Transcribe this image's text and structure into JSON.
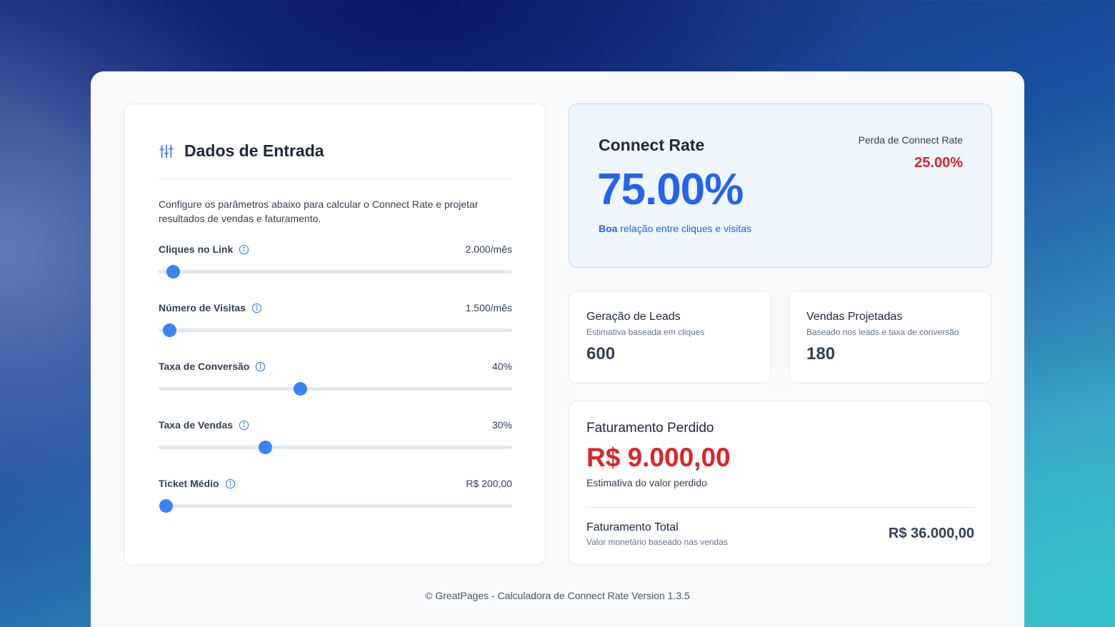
{
  "input": {
    "title": "Dados de Entrada",
    "description": "Configure os parâmetros abaixo para calcular o Connect Rate e projetar resultados de vendas e faturamento.",
    "fields": [
      {
        "label": "Cliques no Link",
        "value": "2.000/mês",
        "slider_fraction": 0.04
      },
      {
        "label": "Número de Visitas",
        "value": "1.500/mês",
        "slider_fraction": 0.03
      },
      {
        "label": "Taxa de Conversão",
        "value": "40%",
        "slider_fraction": 0.4
      },
      {
        "label": "Taxa de Vendas",
        "value": "30%",
        "slider_fraction": 0.3
      },
      {
        "label": "Ticket Médio",
        "value": "R$ 200,00",
        "slider_fraction": 0.02
      }
    ]
  },
  "connect": {
    "title": "Connect Rate",
    "value": "75.00%",
    "note_strong": "Boa",
    "note_rest": "relação entre cliques e visitas",
    "loss_label": "Perda de Connect Rate",
    "loss_value": "25.00%"
  },
  "leads": {
    "title": "Geração de Leads",
    "subtitle": "Estimativa baseada em cliques",
    "value": "600"
  },
  "sales": {
    "title": "Vendas Projetadas",
    "subtitle": "Baseado nos leads e taxa de conversão",
    "value": "180"
  },
  "revenue": {
    "lost_title": "Faturamento Perdido",
    "lost_value": "R$ 9.000,00",
    "lost_sub": "Estimativa do valor perdido",
    "total_title": "Faturamento Total",
    "total_sub": "Valor monetário baseado nas vendas",
    "total_value": "R$ 36.000,00"
  },
  "footer": "© GreatPages - Calculadora de Connect Rate Version 1.3.5",
  "colors": {
    "accent": "#3b82f6",
    "primary_blue": "#2563eb",
    "danger": "#dc2626"
  }
}
